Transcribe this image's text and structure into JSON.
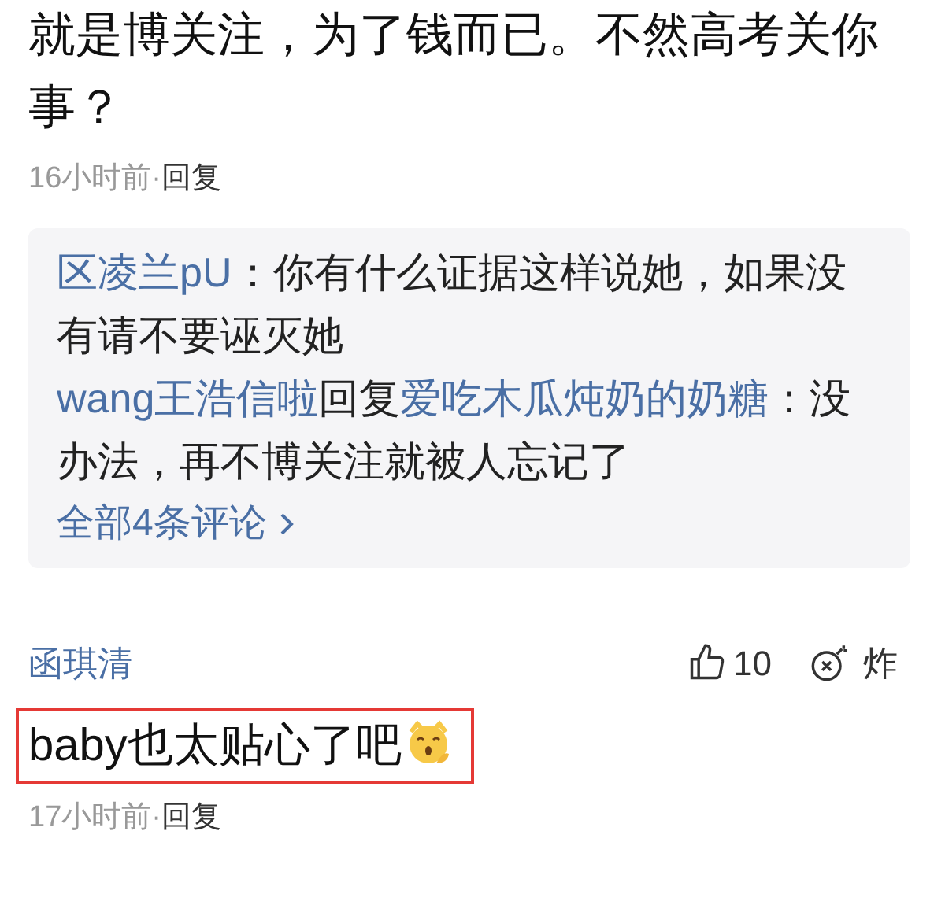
{
  "comments": [
    {
      "text": "就是博关注，为了钱而已。不然高考关你事？",
      "time": "16小时前",
      "separator": "·",
      "reply_button": "回复",
      "replies": [
        {
          "author": "区凌兰pU",
          "colon": "：",
          "text": "你有什么证据这样说她，如果没有请不要诬灭她"
        },
        {
          "author": "wang王浩信啦",
          "connector": "回复",
          "reply_to": "爱吃木瓜炖奶的奶糖",
          "colon": "：",
          "text": "没办法，再不博关注就被人忘记了"
        }
      ],
      "more_link": "全部4条评论"
    },
    {
      "author": "函琪清",
      "likes": "10",
      "bomb_label": "炸",
      "text": "baby也太贴心了吧",
      "emoji": true,
      "highlighted": true,
      "time": "17小时前",
      "separator": "·",
      "reply_button": "回复"
    }
  ]
}
